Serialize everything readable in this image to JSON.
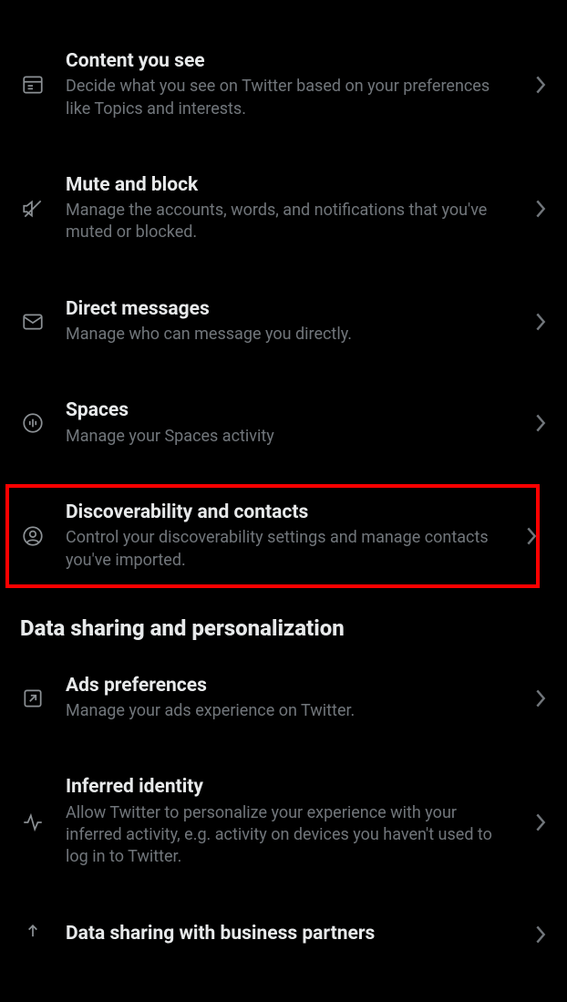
{
  "items": [
    {
      "title": "Content you see",
      "desc": "Decide what you see on Twitter based on your preferences like Topics and interests."
    },
    {
      "title": "Mute and block",
      "desc": "Manage the accounts, words, and notifications that you've muted or blocked."
    },
    {
      "title": "Direct messages",
      "desc": "Manage who can message you directly."
    },
    {
      "title": "Spaces",
      "desc": "Manage your Spaces activity"
    },
    {
      "title": "Discoverability and contacts",
      "desc": "Control your discoverability settings and manage contacts you've imported."
    }
  ],
  "sectionHeader": "Data sharing and personalization",
  "items2": [
    {
      "title": "Ads preferences",
      "desc": "Manage your ads experience on Twitter."
    },
    {
      "title": "Inferred identity",
      "desc": "Allow Twitter to personalize your experience with your inferred activity, e.g. activity on devices you haven't used to log in to Twitter."
    },
    {
      "title": "Data sharing with business partners",
      "desc": ""
    }
  ]
}
